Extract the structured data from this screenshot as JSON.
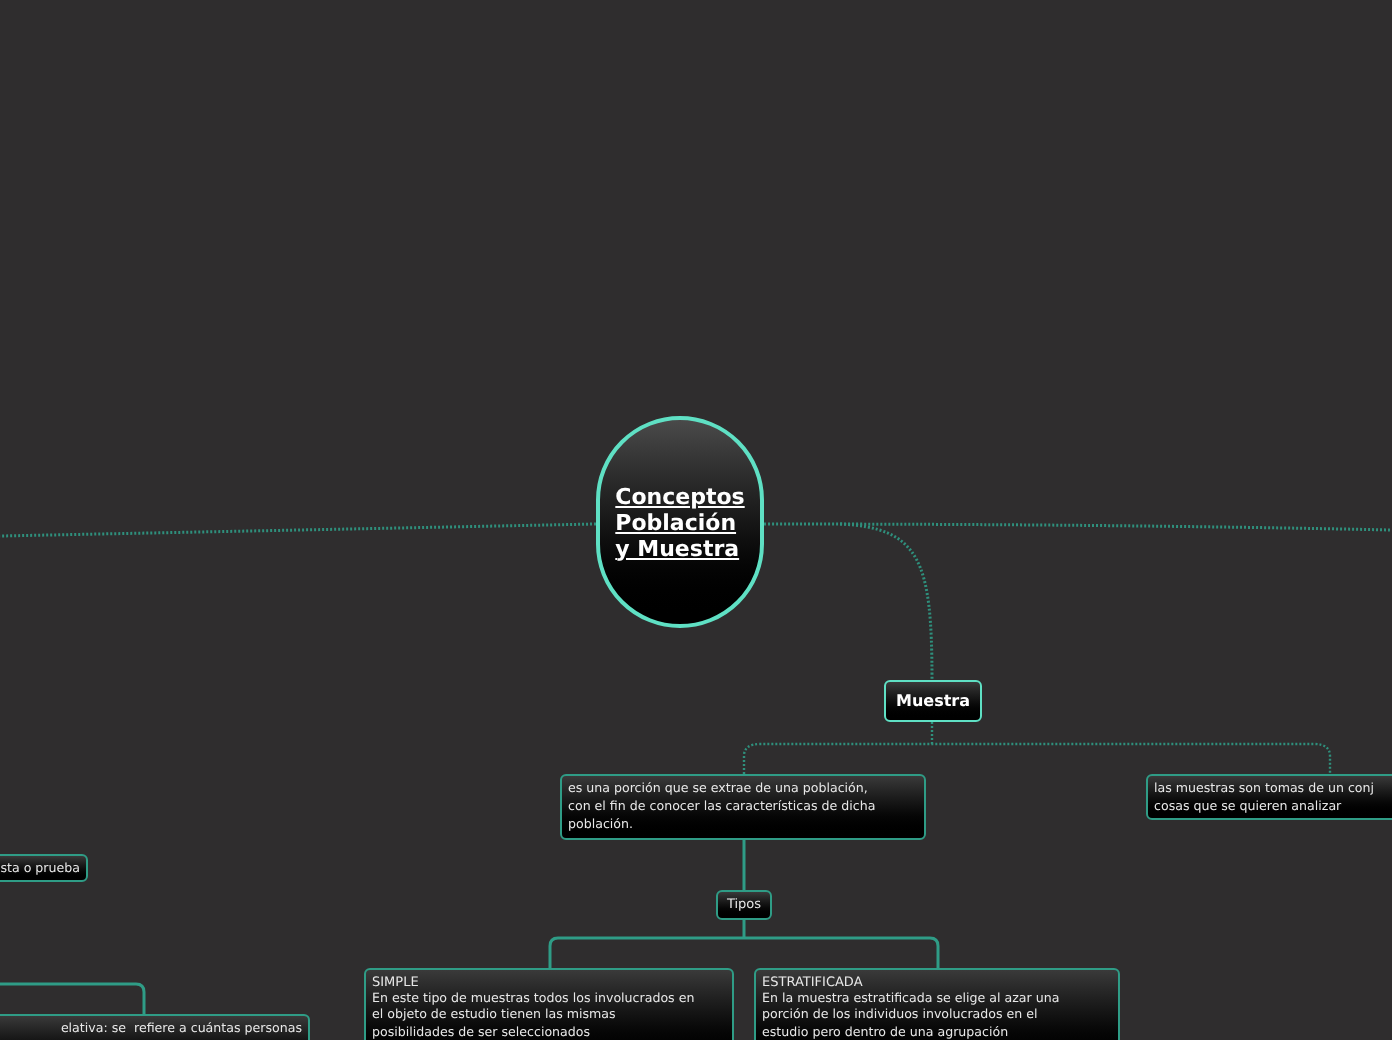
{
  "central": {
    "title": "Conceptos\nPoblación\ny Muestra"
  },
  "nodes": [
    {
      "kind": "topic",
      "text": "Muestra"
    },
    {
      "kind": "note",
      "text": "es una porción que se extrae de una población,\ncon el fin de conocer las características de dicha\npoblación."
    },
    {
      "kind": "note",
      "text": "las muestras son tomas de un conj\ncosas que se quieren analizar"
    },
    {
      "kind": "label",
      "text": "Tipos"
    },
    {
      "kind": "card",
      "title": "SIMPLE",
      "text": "En este tipo de muestras todos los involucrados en\nel objeto de estudio tienen las mismas\nposibilidades de ser seleccionados"
    },
    {
      "kind": "card",
      "title": "ESTRATIFICADA",
      "text": "En la muestra estratificada se elige al azar una\nporción de los individuos involucrados en el\nestudio pero dentro de una agrupación"
    },
    {
      "kind": "note",
      "text": "sta o prueba"
    },
    {
      "kind": "note",
      "text": "elativa: se  refiere a cuántas personas"
    }
  ]
}
